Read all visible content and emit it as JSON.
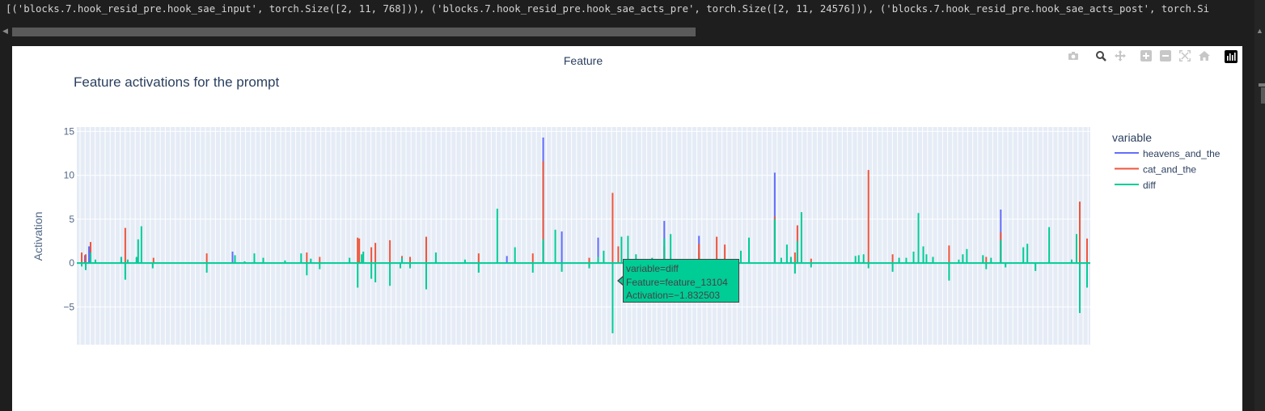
{
  "console": {
    "output_line": "[('blocks.7.hook_resid_pre.hook_sae_input', torch.Size([2, 11, 768])), ('blocks.7.hook_resid_pre.hook_sae_acts_pre', torch.Size([2, 11, 24576])), ('blocks.7.hook_resid_pre.hook_sae_acts_post', torch.Si"
  },
  "modebar": {
    "icons": [
      "camera-icon",
      "zoom-icon",
      "pan-icon",
      "zoom-in-icon",
      "zoom-out-icon",
      "autoscale-icon",
      "reset-axes-icon",
      "plotly-logo-icon"
    ]
  },
  "tooltip": {
    "line1": "variable=diff",
    "line2": "Feature=feature_13104",
    "line3": "Activation=−1.832503"
  },
  "chart_data": {
    "type": "bar",
    "title": "Feature activations for the prompt",
    "xlabel": "Feature",
    "ylabel": "Activation",
    "ylim": [
      -9.3,
      15.5
    ],
    "yticks": [
      {
        "value": -5,
        "label": "−5"
      },
      {
        "value": 0,
        "label": "0"
      },
      {
        "value": 5,
        "label": "5"
      },
      {
        "value": 10,
        "label": "10"
      },
      {
        "value": 15,
        "label": "15"
      }
    ],
    "grid": true,
    "x_tick_labels_shown": false,
    "legend_title": "variable",
    "legend_position": "right",
    "colors": {
      "heavens_and_the": "#636efa",
      "cat_and_the": "#ef553b",
      "diff": "#00cc96"
    },
    "x_index_range": [
      0,
      1250
    ],
    "series": [
      {
        "name": "heavens_and_the",
        "color": "#636efa",
        "points": [
          {
            "x": 7,
            "v": 0.9
          },
          {
            "x": 12,
            "v": 1.9
          },
          {
            "x": 52,
            "v": 0.7
          },
          {
            "x": 71,
            "v": 0.6
          },
          {
            "x": 190,
            "v": 1.3
          },
          {
            "x": 530,
            "v": 0.8
          },
          {
            "x": 575,
            "v": 14.3
          },
          {
            "x": 598,
            "v": 3.6
          },
          {
            "x": 643,
            "v": 2.9
          },
          {
            "x": 725,
            "v": 4.8
          },
          {
            "x": 768,
            "v": 3.1
          },
          {
            "x": 862,
            "v": 10.3
          },
          {
            "x": 1142,
            "v": 6.1
          }
        ]
      },
      {
        "name": "cat_and_the",
        "color": "#ef553b",
        "points": [
          {
            "x": 3,
            "v": 1.2
          },
          {
            "x": 8,
            "v": 1.0
          },
          {
            "x": 14,
            "v": 2.4
          },
          {
            "x": 57,
            "v": 4.0
          },
          {
            "x": 92,
            "v": 0.6
          },
          {
            "x": 158,
            "v": 1.1
          },
          {
            "x": 282,
            "v": 1.2
          },
          {
            "x": 298,
            "v": 0.7
          },
          {
            "x": 345,
            "v": 2.9
          },
          {
            "x": 347,
            "v": 2.8
          },
          {
            "x": 362,
            "v": 1.8
          },
          {
            "x": 367,
            "v": 2.3
          },
          {
            "x": 385,
            "v": 2.6
          },
          {
            "x": 400,
            "v": 0.8
          },
          {
            "x": 410,
            "v": 0.7
          },
          {
            "x": 430,
            "v": 3.0
          },
          {
            "x": 495,
            "v": 1.1
          },
          {
            "x": 562,
            "v": 1.1
          },
          {
            "x": 575,
            "v": 11.6
          },
          {
            "x": 632,
            "v": 0.6
          },
          {
            "x": 661,
            "v": 8.0
          },
          {
            "x": 668,
            "v": 1.9
          },
          {
            "x": 725,
            "v": 1.9
          },
          {
            "x": 768,
            "v": 2.2
          },
          {
            "x": 768,
            "v": 1.2
          },
          {
            "x": 790,
            "v": 3.0
          },
          {
            "x": 800,
            "v": 2.1
          },
          {
            "x": 862,
            "v": 5.3
          },
          {
            "x": 887,
            "v": 1.2
          },
          {
            "x": 890,
            "v": 4.3
          },
          {
            "x": 907,
            "v": 0.5
          },
          {
            "x": 978,
            "v": 10.6
          },
          {
            "x": 1008,
            "v": 1.0
          },
          {
            "x": 1078,
            "v": 2.0
          },
          {
            "x": 1124,
            "v": 0.7
          },
          {
            "x": 1142,
            "v": 3.5
          },
          {
            "x": 1240,
            "v": 7.0
          },
          {
            "x": 1249,
            "v": 2.8
          }
        ]
      },
      {
        "name": "diff",
        "color": "#00cc96",
        "points": [
          {
            "x": 3,
            "v": -0.4
          },
          {
            "x": 8,
            "v": -0.8
          },
          {
            "x": 14,
            "v": 1.2
          },
          {
            "x": 20,
            "v": 0.4
          },
          {
            "x": 52,
            "v": 0.7
          },
          {
            "x": 57,
            "v": -1.9
          },
          {
            "x": 60,
            "v": 0.4
          },
          {
            "x": 71,
            "v": 0.7
          },
          {
            "x": 73,
            "v": 2.7
          },
          {
            "x": 77,
            "v": 4.2
          },
          {
            "x": 91,
            "v": -0.6
          },
          {
            "x": 158,
            "v": -1.1
          },
          {
            "x": 193,
            "v": 0.9
          },
          {
            "x": 205,
            "v": 0.2
          },
          {
            "x": 217,
            "v": 1.1
          },
          {
            "x": 228,
            "v": 0.6
          },
          {
            "x": 255,
            "v": 0.3
          },
          {
            "x": 275,
            "v": 1.1
          },
          {
            "x": 282,
            "v": -1.4
          },
          {
            "x": 287,
            "v": 0.5
          },
          {
            "x": 298,
            "v": -0.7
          },
          {
            "x": 335,
            "v": 0.6
          },
          {
            "x": 345,
            "v": -2.8
          },
          {
            "x": 350,
            "v": 1.0
          },
          {
            "x": 352,
            "v": 1.3
          },
          {
            "x": 362,
            "v": -1.8
          },
          {
            "x": 367,
            "v": -2.2
          },
          {
            "x": 385,
            "v": -2.6
          },
          {
            "x": 398,
            "v": -0.6
          },
          {
            "x": 400,
            "v": 0.6
          },
          {
            "x": 410,
            "v": -0.6
          },
          {
            "x": 430,
            "v": -3.0
          },
          {
            "x": 442,
            "v": 1.2
          },
          {
            "x": 478,
            "v": 0.4
          },
          {
            "x": 495,
            "v": -1.1
          },
          {
            "x": 518,
            "v": 6.2
          },
          {
            "x": 540,
            "v": 1.8
          },
          {
            "x": 562,
            "v": -1.1
          },
          {
            "x": 575,
            "v": 2.7
          },
          {
            "x": 590,
            "v": 3.8
          },
          {
            "x": 598,
            "v": -1.0
          },
          {
            "x": 632,
            "v": -0.6
          },
          {
            "x": 643,
            "v": 0.7
          },
          {
            "x": 650,
            "v": 1.4
          },
          {
            "x": 661,
            "v": -8.0
          },
          {
            "x": 672,
            "v": 3.0
          },
          {
            "x": 680,
            "v": 3.1
          },
          {
            "x": 690,
            "v": 1.0
          },
          {
            "x": 710,
            "v": 0.6
          },
          {
            "x": 725,
            "v": 2.8
          },
          {
            "x": 733,
            "v": 3.3
          },
          {
            "x": 768,
            "v": -1.0
          },
          {
            "x": 820,
            "v": 1.4
          },
          {
            "x": 830,
            "v": 2.9
          },
          {
            "x": 862,
            "v": 5.0
          },
          {
            "x": 870,
            "v": 0.6
          },
          {
            "x": 877,
            "v": 2.1
          },
          {
            "x": 882,
            "v": 0.7
          },
          {
            "x": 887,
            "v": -1.2
          },
          {
            "x": 890,
            "v": 2.5
          },
          {
            "x": 895,
            "v": 5.8
          },
          {
            "x": 907,
            "v": -0.5
          },
          {
            "x": 962,
            "v": 0.8
          },
          {
            "x": 966,
            "v": 0.9
          },
          {
            "x": 972,
            "v": 1.0
          },
          {
            "x": 978,
            "v": -0.6
          },
          {
            "x": 1008,
            "v": -1.0
          },
          {
            "x": 1016,
            "v": 0.6
          },
          {
            "x": 1025,
            "v": 0.6
          },
          {
            "x": 1034,
            "v": 1.3
          },
          {
            "x": 1040,
            "v": 5.7
          },
          {
            "x": 1046,
            "v": 1.9
          },
          {
            "x": 1050,
            "v": 1.0
          },
          {
            "x": 1058,
            "v": 0.7
          },
          {
            "x": 1078,
            "v": -2.0
          },
          {
            "x": 1090,
            "v": 0.4
          },
          {
            "x": 1095,
            "v": 1.0
          },
          {
            "x": 1100,
            "v": 1.6
          },
          {
            "x": 1120,
            "v": 0.9
          },
          {
            "x": 1124,
            "v": -0.7
          },
          {
            "x": 1130,
            "v": 0.6
          },
          {
            "x": 1142,
            "v": 2.6
          },
          {
            "x": 1148,
            "v": -0.5
          },
          {
            "x": 1170,
            "v": 1.8
          },
          {
            "x": 1175,
            "v": 2.2
          },
          {
            "x": 1185,
            "v": -0.9
          },
          {
            "x": 1202,
            "v": 4.1
          },
          {
            "x": 1230,
            "v": 0.4
          },
          {
            "x": 1236,
            "v": 3.3
          },
          {
            "x": 1240,
            "v": -5.7
          },
          {
            "x": 1249,
            "v": -2.8
          }
        ]
      }
    ]
  }
}
